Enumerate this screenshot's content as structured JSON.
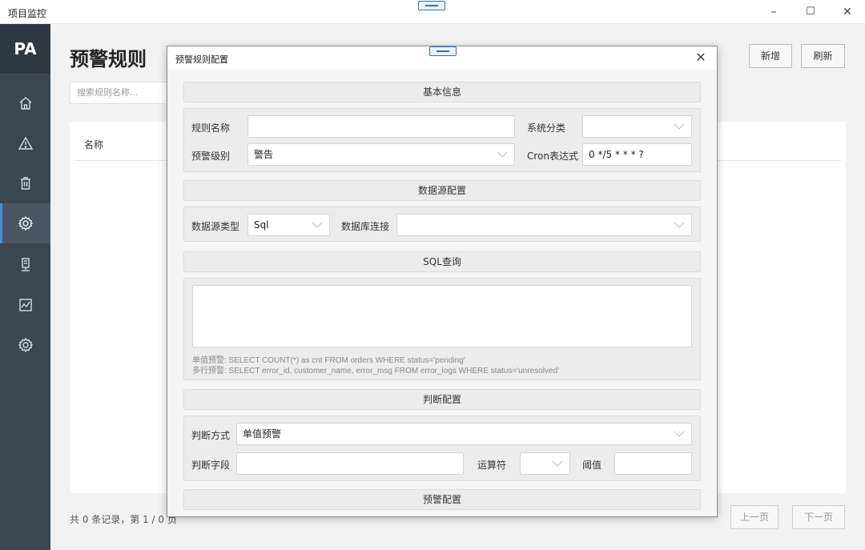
{
  "window": {
    "title": "项目监控",
    "minimize": "–",
    "maximize": "☐",
    "close": "✕"
  },
  "sidebar": {
    "logo": "PA",
    "items": [
      {
        "icon": "home-icon"
      },
      {
        "icon": "warning-icon"
      },
      {
        "icon": "trash-icon"
      },
      {
        "icon": "gear-icon",
        "active": true
      },
      {
        "icon": "server-icon"
      },
      {
        "icon": "chart-icon"
      },
      {
        "icon": "settings-icon"
      }
    ]
  },
  "main": {
    "title": "预警规则",
    "add_label": "新增",
    "refresh_label": "刷新",
    "search_placeholder": "搜索规则名称...",
    "table": {
      "columns": [
        "名称"
      ]
    },
    "footer": "共 0 条记录，第 1 / 0 页",
    "prev_label": "上一页",
    "next_label": "下一页"
  },
  "dialog": {
    "title": "预警规则配置",
    "close": "✕",
    "sections": {
      "basic": "基本信息",
      "datasource": "数据源配置",
      "sql": "SQL查询",
      "judge": "判断配置",
      "alert": "预警配置"
    },
    "basic": {
      "rule_name_label": "规则名称",
      "rule_name_value": "",
      "category_label": "系统分类",
      "category_value": "",
      "level_label": "预警级别",
      "level_value": "警告",
      "cron_label": "Cron表达式",
      "cron_value": "0 */5 * * * ?"
    },
    "datasource": {
      "type_label": "数据源类型",
      "type_value": "Sql",
      "conn_label": "数据库连接",
      "conn_value": ""
    },
    "sql": {
      "query_value": "",
      "hint1": "单值预警: SELECT COUNT(*) as cnt FROM orders WHERE status='pending'",
      "hint2": "多行预警: SELECT error_id, customer_name, error_msg FROM error_logs WHERE status='unresolved'"
    },
    "judge": {
      "mode_label": "判断方式",
      "mode_value": "单值预警",
      "field_label": "判断字段",
      "field_value": "",
      "operator_label": "运算符",
      "operator_value": "",
      "threshold_label": "阈值",
      "threshold_value": ""
    }
  }
}
